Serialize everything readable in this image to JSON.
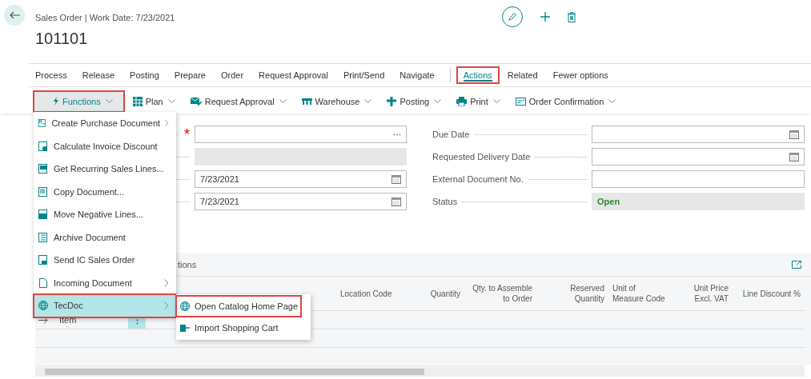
{
  "header": {
    "breadcrumb": "Sales Order | Work Date: 7/23/2021",
    "title": "101101"
  },
  "tab_groups": [
    [
      {
        "label": "Process",
        "selected": false,
        "highlighted": false
      },
      {
        "label": "Release",
        "selected": false,
        "highlighted": false
      },
      {
        "label": "Posting",
        "selected": false,
        "highlighted": false
      },
      {
        "label": "Prepare",
        "selected": false,
        "highlighted": false
      },
      {
        "label": "Order",
        "selected": false,
        "highlighted": false
      },
      {
        "label": "Request Approval",
        "selected": false,
        "highlighted": false
      },
      {
        "label": "Print/Send",
        "selected": false,
        "highlighted": false
      },
      {
        "label": "Navigate",
        "selected": false,
        "highlighted": false
      }
    ],
    [
      {
        "label": "Actions",
        "selected": true,
        "highlighted": true
      },
      {
        "label": "Related",
        "selected": false,
        "highlighted": false
      },
      {
        "label": "Fewer options",
        "selected": false,
        "highlighted": false
      }
    ]
  ],
  "actions": [
    {
      "label": "Functions",
      "selected": true,
      "highlighted": true
    },
    {
      "label": "Plan",
      "selected": false,
      "highlighted": false
    },
    {
      "label": "Request Approval",
      "selected": false,
      "highlighted": false
    },
    {
      "label": "Warehouse",
      "selected": false,
      "highlighted": false
    },
    {
      "label": "Posting",
      "selected": false,
      "highlighted": false
    },
    {
      "label": "Print",
      "selected": false,
      "highlighted": false
    },
    {
      "label": "Order Confirmation",
      "selected": false,
      "highlighted": false
    }
  ],
  "form": {
    "left": [
      {
        "kind": "lookup",
        "marker": "*"
      },
      {
        "kind": "readonly"
      },
      {
        "kind": "date",
        "value": "7/23/2021"
      },
      {
        "kind": "date",
        "value": "7/23/2021"
      }
    ],
    "right": [
      {
        "label": "Due Date",
        "kind": "date"
      },
      {
        "label": "Requested Delivery Date",
        "kind": "date"
      },
      {
        "label": "External Document No.",
        "kind": "text"
      },
      {
        "label": "Status",
        "kind": "readonly",
        "value": "Open"
      }
    ]
  },
  "lines": {
    "title": "tions",
    "columns": [
      {
        "label": "Location Code",
        "numeric": false
      },
      {
        "label": "Quantity",
        "numeric": true
      },
      {
        "label": "Qty. to Assemble to Order",
        "numeric": true
      },
      {
        "label": "Reserved Quantity",
        "numeric": true
      },
      {
        "label": "Unit of Measure Code",
        "numeric": false
      },
      {
        "label": "Unit Price Excl. VAT",
        "numeric": true
      },
      {
        "label": "Line Discount %",
        "numeric": true
      }
    ],
    "rows": [
      {
        "type": "Item",
        "selected": true
      }
    ]
  },
  "menu": {
    "items": [
      {
        "label": "Create Purchase Document",
        "submenu": true,
        "selected": false,
        "highlighted": false
      },
      {
        "label": "Calculate Invoice Discount",
        "submenu": false,
        "selected": false,
        "highlighted": false
      },
      {
        "label": "Get Recurring Sales Lines...",
        "submenu": false,
        "selected": false,
        "highlighted": false
      },
      {
        "label": "Copy Document...",
        "submenu": false,
        "selected": false,
        "highlighted": false
      },
      {
        "label": "Move Negative Lines...",
        "submenu": false,
        "selected": false,
        "highlighted": false
      },
      {
        "label": "Archive Document",
        "submenu": false,
        "selected": false,
        "highlighted": false
      },
      {
        "label": "Send IC Sales Order",
        "submenu": false,
        "selected": false,
        "highlighted": false
      },
      {
        "label": "Incoming Document",
        "submenu": true,
        "selected": false,
        "highlighted": false
      },
      {
        "label": "TecDoc",
        "submenu": true,
        "selected": true,
        "highlighted": true
      }
    ]
  },
  "submenu": {
    "items": [
      {
        "label": "Open Catalog Home Page",
        "highlighted": true
      },
      {
        "label": "Import Shopping Cart",
        "highlighted": false
      }
    ]
  }
}
